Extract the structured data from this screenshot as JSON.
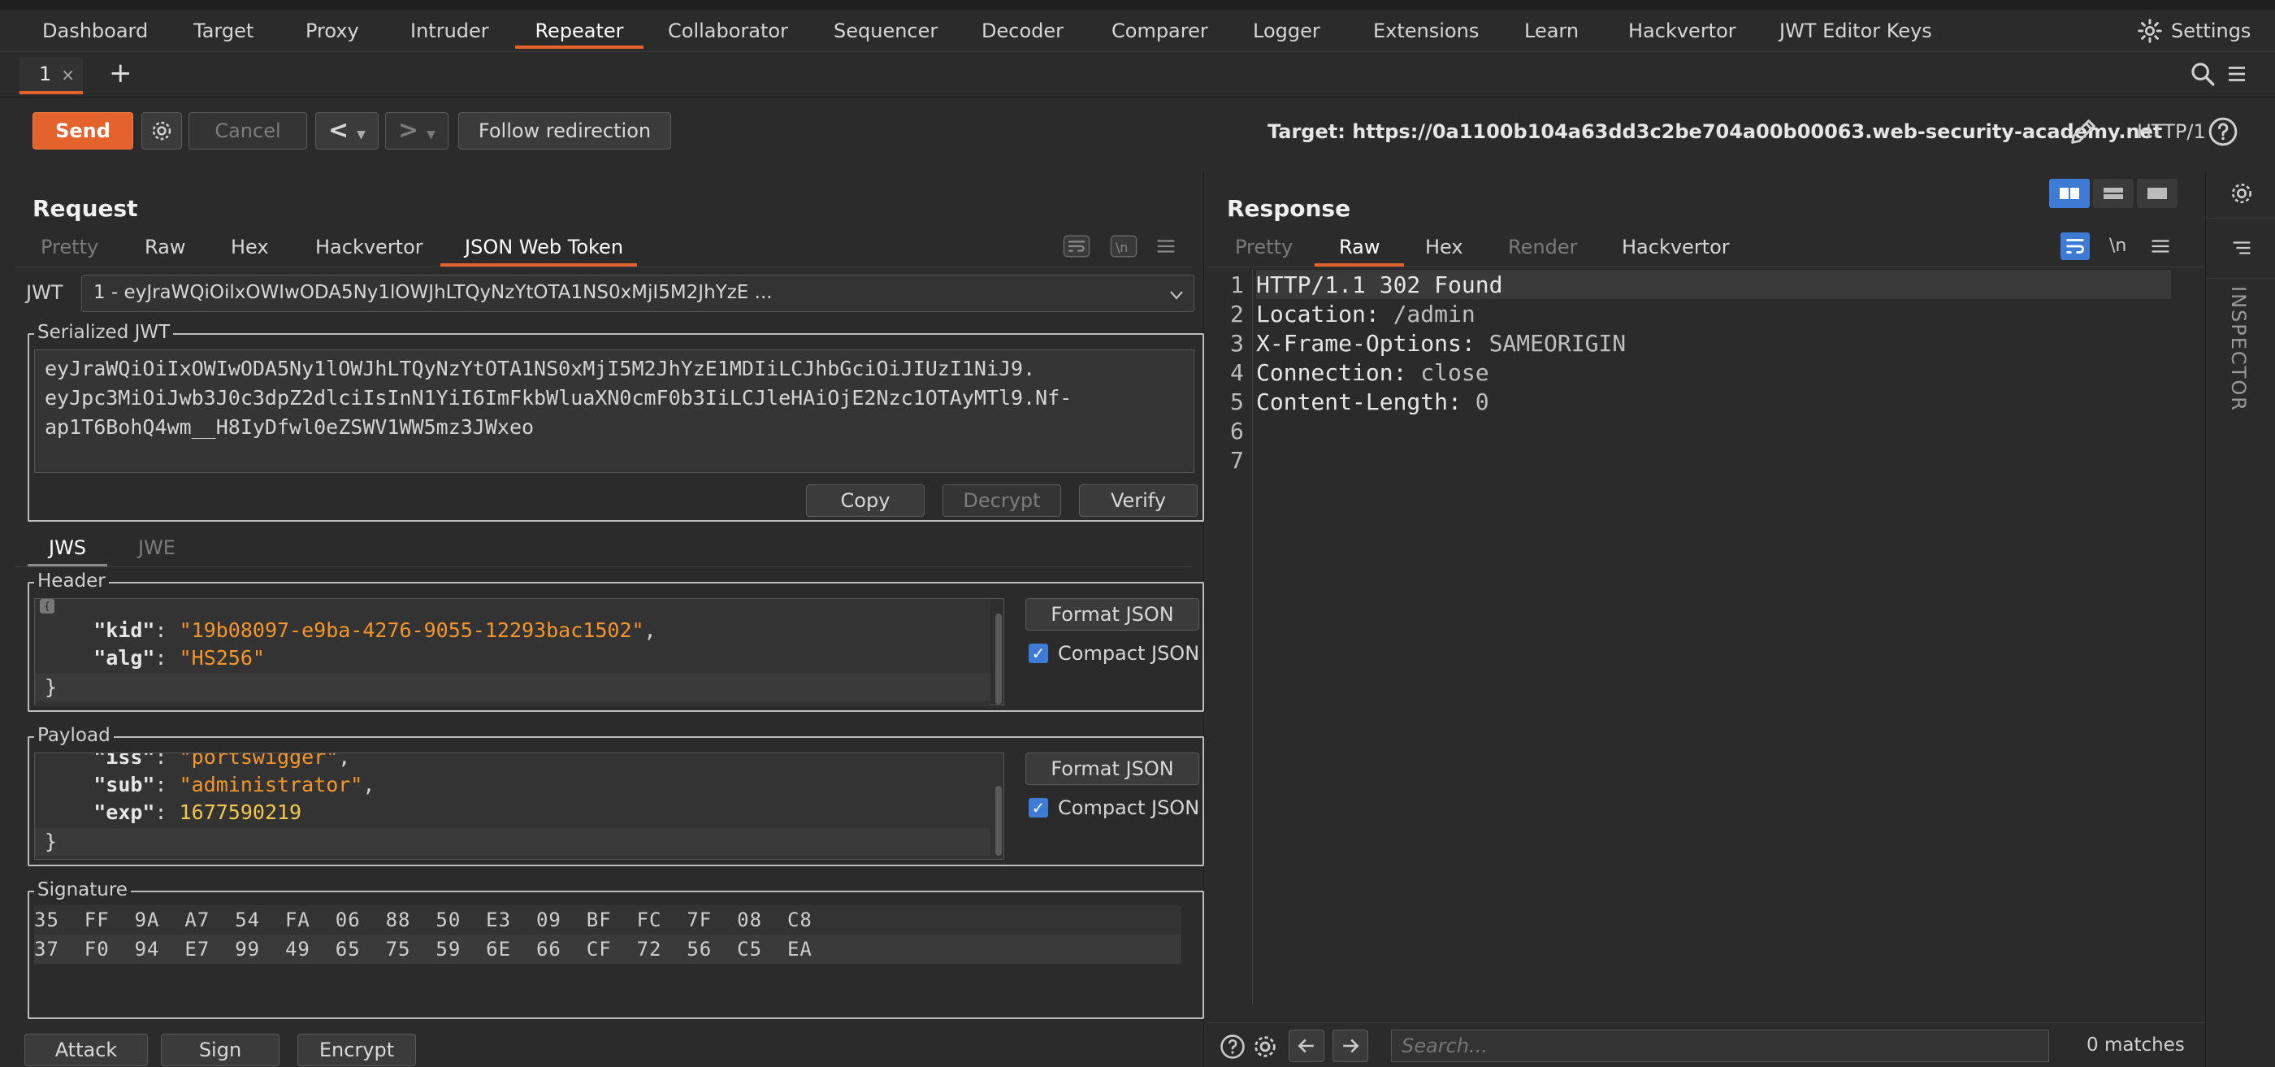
{
  "menu": {
    "items": [
      "Dashboard",
      "Target",
      "Proxy",
      "Intruder",
      "Repeater",
      "Collaborator",
      "Sequencer",
      "Decoder",
      "Comparer",
      "Logger",
      "Extensions",
      "Learn",
      "Hackvertor",
      "JWT Editor Keys"
    ],
    "active": "Repeater",
    "settings_label": "Settings"
  },
  "tabs": {
    "tab1_label": "1",
    "tab1_close": "×",
    "add": "+"
  },
  "toolbar": {
    "send": "Send",
    "cancel": "Cancel",
    "back": "<",
    "forward": ">",
    "follow": "Follow redirection",
    "target": "Target: https://0a1100b104a63dd3c2be704a00b00063.web-security-academy.net",
    "http": "HTTP/1"
  },
  "request": {
    "title": "Request",
    "tabs": [
      "Pretty",
      "Raw",
      "Hex",
      "Hackvertor",
      "JSON Web Token"
    ],
    "active_tab": "JSON Web Token",
    "jwt_label": "JWT",
    "jwt_select": "1 - eyJraWQiOilxOWIwODA5Ny1lOWJhLTQyNzYtOTA1NS0xMjI5M2JhYzE ...",
    "serialized_legend": "Serialized JWT",
    "serialized_lines": [
      "eyJraWQiOiIxOWIwODA5Ny1lOWJhLTQyNzYtOTA1NS0xMjI5M2JhYzE1MDIiLCJhbGciOiJIUzI1NiJ9.",
      "eyJpc3MiOiJwb3J0c3dpZ2dlciIsInN1YiI6ImFkbWluaXN0cmF0b3IiLCJleHAiOjE2Nzc1OTAyMTl9.Nf-",
      "ap1T6BohQ4wm__H8IyDfwl0eZSWV1WW5mz3JWxeo"
    ],
    "copy": "Copy",
    "decrypt": "Decrypt",
    "verify": "Verify",
    "jws_tab": "JWS",
    "jwe_tab": "JWE",
    "header_legend": "Header",
    "header_lines": {
      "kid_key": "\"kid\"",
      "kid_val": "\"19b08097-e9ba-4276-9055-12293bac1502\"",
      "alg_key": "\"alg\"",
      "alg_val": "\"HS256\"",
      "close": "}"
    },
    "format_json": "Format JSON",
    "compact_json": "Compact JSON",
    "payload_legend": "Payload",
    "payload_lines": {
      "iss_key": "\"iss\"",
      "iss_val": "\"portswigger\"",
      "sub_key": "\"sub\"",
      "sub_val": "\"administrator\"",
      "exp_key": "\"exp\"",
      "exp_val": "1677590219",
      "close": "}"
    },
    "signature_legend": "Signature",
    "signature_rows": [
      "35  FF  9A  A7  54  FA  06  88  50  E3  09  BF  FC  7F  08  C8",
      "37  F0  94  E7  99  49  65  75  59  6E  66  CF  72  56  C5  EA"
    ],
    "attack": "Attack",
    "sign": "Sign",
    "encrypt": "Encrypt"
  },
  "response": {
    "title": "Response",
    "tabs": [
      "Pretty",
      "Raw",
      "Hex",
      "Render",
      "Hackvertor"
    ],
    "active_tab": "Raw",
    "lines": [
      {
        "n": "1",
        "k": "HTTP/1.1 302 Found",
        "v": ""
      },
      {
        "n": "2",
        "k": "Location:",
        "v": " /admin"
      },
      {
        "n": "3",
        "k": "X-Frame-Options:",
        "v": " SAMEORIGIN"
      },
      {
        "n": "4",
        "k": "Connection:",
        "v": " close"
      },
      {
        "n": "5",
        "k": "Content-Length:",
        "v": " 0"
      },
      {
        "n": "6",
        "k": "",
        "v": ""
      },
      {
        "n": "7",
        "k": "",
        "v": ""
      }
    ],
    "search_placeholder": "Search...",
    "matches": "0 matches"
  },
  "inspector": {
    "label": "INSPECTOR"
  },
  "colors": {
    "accent": "#e4632c",
    "string": "#f5962b",
    "number": "#f3c84a",
    "check": "#3d7bd5"
  }
}
